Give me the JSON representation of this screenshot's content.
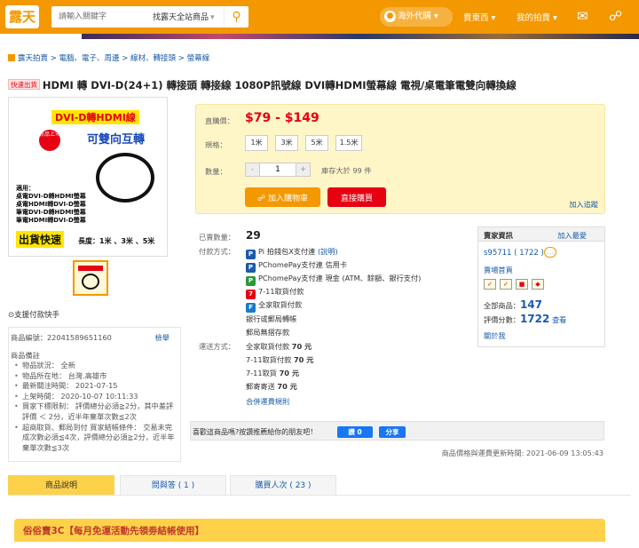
{
  "header": {
    "logo": "露天",
    "search_placeholder": "請輸入關鍵字",
    "search_scope": "找露天全站商品",
    "overseas": "海外代購",
    "nav1": "賣東西",
    "nav2": "我的拍賣"
  },
  "breadcrumb": "露天拍賣 > 電腦、電子、周邊 > 線材、轉接頭 > 螢幕線",
  "product": {
    "tag": "快速出貨",
    "title": "HDMI 轉 DVI-D(24+1) 轉接頭 轉接線 1080P訊號線 DVI轉HDMI螢幕線 電視/桌電筆電雙向轉換線",
    "image_title": "DVI-D轉HDMI線",
    "image_subtitle": "可雙向互轉",
    "image_new": "新品上市",
    "image_usage": [
      "適用：",
      "桌電DVI-D轉HDMI螢幕",
      "桌電HDMI轉DVI-D螢幕",
      "筆電DVI-D轉HDMI螢幕",
      "筆電HDMI轉DVI-D螢幕"
    ],
    "image_ship": "出貨快速",
    "image_length": "長度：1米 、3米 、5米"
  },
  "support": "⊙支援付款快手",
  "info_panel": {
    "code_label": "商品編號：",
    "code_value": "22041589651160",
    "report": "檢舉",
    "notes_label": "商品備註",
    "items": [
      "物品狀況： 全新",
      "物品所在地： 台灣.高雄市",
      "最新關注時間： 2021-07-15",
      "上架時間： 2020-10-07 10:11:33",
      "買家下標限制： 評價總分必須≧2分，其中差評評價 ＜ 2分，近半年棄單次數≦2次",
      "超商取貨、郵局到付 買家結帳條件： 交易未完成次數必須≦4次，評價總分必須≧2分，近半年棄單次數≦3次"
    ]
  },
  "buy": {
    "price_label": "直購價：",
    "price": "$79 - $149",
    "spec_label": "規格：",
    "specs": [
      "1米",
      "3米",
      "5米",
      "1.5米"
    ],
    "qty_label": "數量：",
    "qty_minus": "-",
    "qty": "1",
    "qty_plus": "+",
    "stock": "庫存大於 99 件",
    "add_cart": "加入購物車",
    "buy_now": "直接購買",
    "track": "加入追蹤"
  },
  "sales": {
    "sold_label": "已賣數量：",
    "sold": "29",
    "pay_label": "付款方式：",
    "pay_pi": "Pi 拍錢包X支付連",
    "pay_pi_link": "(說明)",
    "pay_pchome1": "PChomePay支付連 信用卡",
    "pay_pchome2": "PChomePay支付連 現金 (ATM、餘額、銀行支付)",
    "pay_711": "7-11取貨付款",
    "pay_family": "全家取貨付款",
    "pay_bank": "銀行或郵局轉帳",
    "pay_post": "郵局無摺存款",
    "ship_label": "運送方式：",
    "ship_family": "全家取貨付款",
    "ship_family_price": "70 元",
    "ship_711_pay": "7-11取貨付款",
    "ship_711_pay_price": "70 元",
    "ship_711": "7-11取貨",
    "ship_711_price": "70 元",
    "ship_post": "郵寄寄送",
    "ship_post_price": "70 元",
    "ship_more": "合併運費規則"
  },
  "seller": {
    "title": "賣家資訊",
    "follow": "加入最愛",
    "name": "s95711 ( 1722 )",
    "home": "賣場首頁",
    "all_label": "全部商品：",
    "all": "147",
    "score_label": "評價分數：",
    "score": "1722",
    "score_link": "查看",
    "about": "關於我"
  },
  "like": {
    "text": "喜歡這商品嗎?按讚推薦給你的朋友吧！",
    "fb": "讚 0",
    "share": "分享"
  },
  "update": "商品價格與運費更新時間: 2021-06-09 13:05:43",
  "tabs": [
    "商品說明",
    "問與答 ( 1 )",
    "購買人次 ( 23 )"
  ],
  "shopbar": "俗俗賣3C【每月免運活動先領劵結帳使用】"
}
